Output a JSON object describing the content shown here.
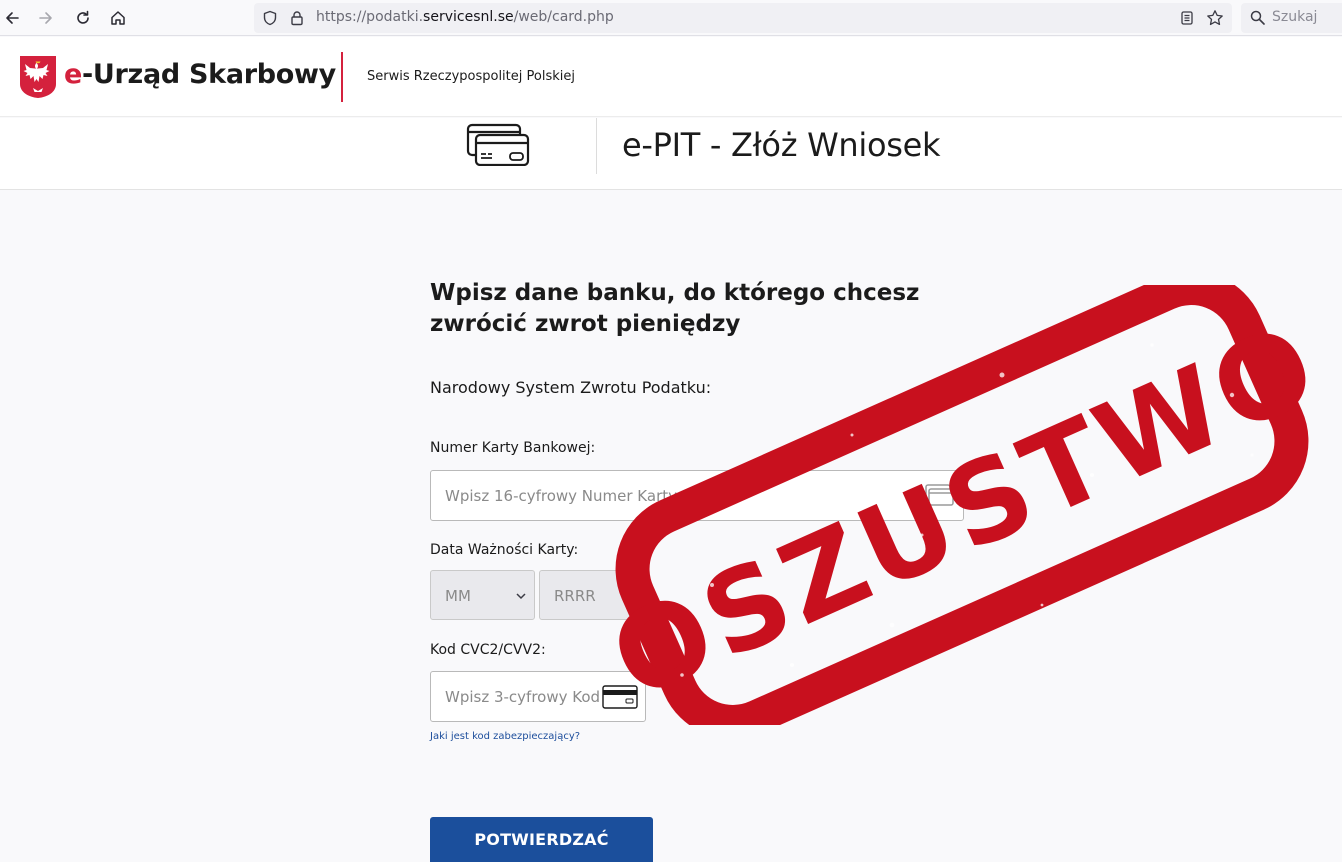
{
  "browser": {
    "url_prefix": "https://podatki.",
    "url_domain": "servicesnl.se",
    "url_path": "/web/card.php",
    "search_placeholder": "Szukaj"
  },
  "header": {
    "brand_e": "e",
    "brand_rest": "-Urząd Skarbowy",
    "subtitle": "Serwis Rzeczypospolitej Polskiej"
  },
  "subheader": {
    "title": "e-PIT - Złóż Wniosek"
  },
  "form": {
    "title": "Wpisz dane banku, do którego chcesz zwrócić zwrot pieniędzy",
    "intro": "Narodowy System Zwrotu Podatku:",
    "card_number_label": "Numer Karty Bankowej:",
    "card_number_placeholder": "Wpisz 16-cyfrowy Numer Karty",
    "expiry_label": "Data Ważności Karty:",
    "month_value": "MM",
    "year_value": "RRRR",
    "cvc_label": "Kod CVC2/CVV2:",
    "cvc_placeholder": "Wpisz 3-cyfrowy Kod",
    "help_link": "Jaki jest kod zabezpieczający?",
    "submit_label": "POTWIERDZAĆ"
  },
  "stamp": {
    "text": "OSZUSTWO",
    "color": "#c8101e"
  },
  "colors": {
    "brand_red": "#d4213d",
    "button_blue": "#1b4f9c",
    "link_blue": "#1d4e9c"
  }
}
